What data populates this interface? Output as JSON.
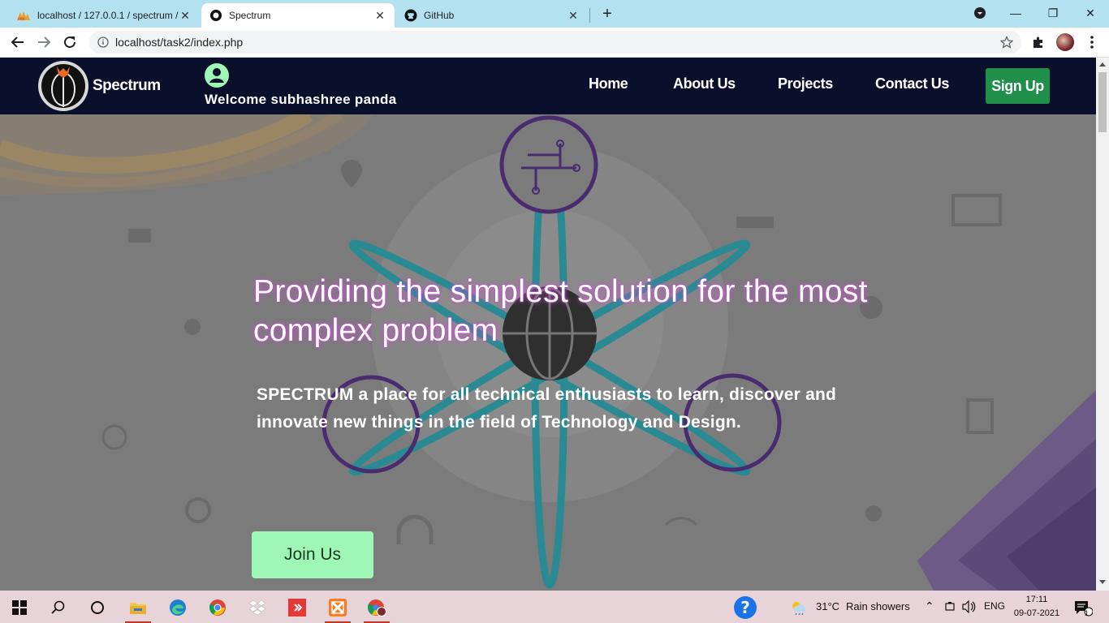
{
  "browser": {
    "tabs": [
      {
        "title": "localhost / 127.0.0.1 / spectrum / ",
        "active": false
      },
      {
        "title": "Spectrum",
        "active": true
      },
      {
        "title": "GitHub",
        "active": false
      }
    ],
    "url": "localhost/task2/index.php",
    "new_tab_label": "+"
  },
  "site": {
    "brand": "Spectrum",
    "welcome": "Welcome subhashree panda",
    "nav": [
      "Home",
      "About Us",
      "Projects",
      "Contact Us"
    ],
    "signup": "Sign Up"
  },
  "hero": {
    "title": "Providing the simplest solution for the most complex problem",
    "subtitle": "SPECTRUM a place for all technical enthusiasts to learn, discover and innovate new things in the field of Technology and Design.",
    "cta": "Join Us"
  },
  "taskbar": {
    "weather_temp": "31°C",
    "weather_desc": "Rain showers",
    "lang": "ENG",
    "time": "17:11",
    "date": "09-07-2021",
    "notification_count": "1"
  },
  "colors": {
    "nav_bg": "#0a0f2c",
    "signup_bg": "#1f8f4a",
    "join_bg": "#9ef7b4",
    "tabstrip_bg": "#b3e1f0"
  }
}
